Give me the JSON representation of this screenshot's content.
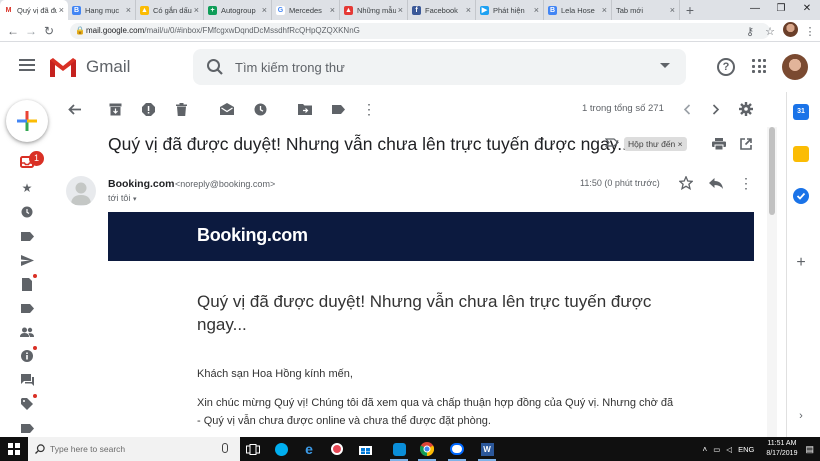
{
  "browser": {
    "tabs": [
      {
        "title": "Quý vị đã được duyệt!",
        "color": "#ffffff",
        "glyph": "M",
        "glyph_color": "#d93025",
        "active": true
      },
      {
        "title": "Hang mục",
        "color": "#4285f4",
        "glyph": "B"
      },
      {
        "title": "Có gắn dấu sao",
        "color": "#fbbc04",
        "glyph": "▲"
      },
      {
        "title": "Autogroup",
        "color": "#0f9d58",
        "glyph": "+"
      },
      {
        "title": "Mercedes",
        "color": "#ffffff",
        "glyph": "G",
        "glyph_color": "#4285f4"
      },
      {
        "title": "Những mẫu",
        "color": "#e53935",
        "glyph": "▲"
      },
      {
        "title": "Facebook",
        "color": "#3b5998",
        "glyph": "f"
      },
      {
        "title": "Phát hiện",
        "color": "#1da1f2",
        "glyph": "▶"
      },
      {
        "title": "Lela Hose",
        "color": "#4285f4",
        "glyph": "B"
      },
      {
        "title": "Tab mới",
        "color": "",
        "glyph": ""
      }
    ],
    "new_tab": "+",
    "url_host": "mail.google.com",
    "url_path": "/mail/u/0/#inbox/FMfcgxwDqndDcMssdhfRcQHpQZQXKNnG"
  },
  "gmail": {
    "logo_text": "Gmail",
    "search_placeholder": "Tìm kiếm trong thư",
    "unread_badge": "1",
    "pager": "1 trong tổng số 271",
    "label_chip": "Hộp thư đến ×"
  },
  "email": {
    "subject": "Quý vị đã được duyệt! Nhưng vẫn chưa lên trực tuyến được ngay...",
    "sender_name": "Booking.com",
    "sender_email": "<noreply@booking.com>",
    "to": "tới tôi",
    "time": "11:50 (0 phút trước)",
    "brand_logo": "Booking.com",
    "body_title": "Quý vị đã được duyệt! Nhưng vẫn chưa lên trực tuyến được ngay...",
    "greeting": "Khách sạn Hoa Hồng kính mến,",
    "paragraph": "Xin chúc mừng Quý vị! Chúng tôi đã xem qua và chấp thuận hợp đồng của Quý vị. Nhưng chờ đã - Quý vị vẫn chưa được online và chưa thể được đặt phòng."
  },
  "taskbar": {
    "search_placeholder": "Type here to search",
    "language": "ENG",
    "time": "11:51 AM",
    "date": "8/17/2019"
  },
  "colors": {
    "booking_navy": "#0c1a3f",
    "gmail_red": "#d93025"
  }
}
